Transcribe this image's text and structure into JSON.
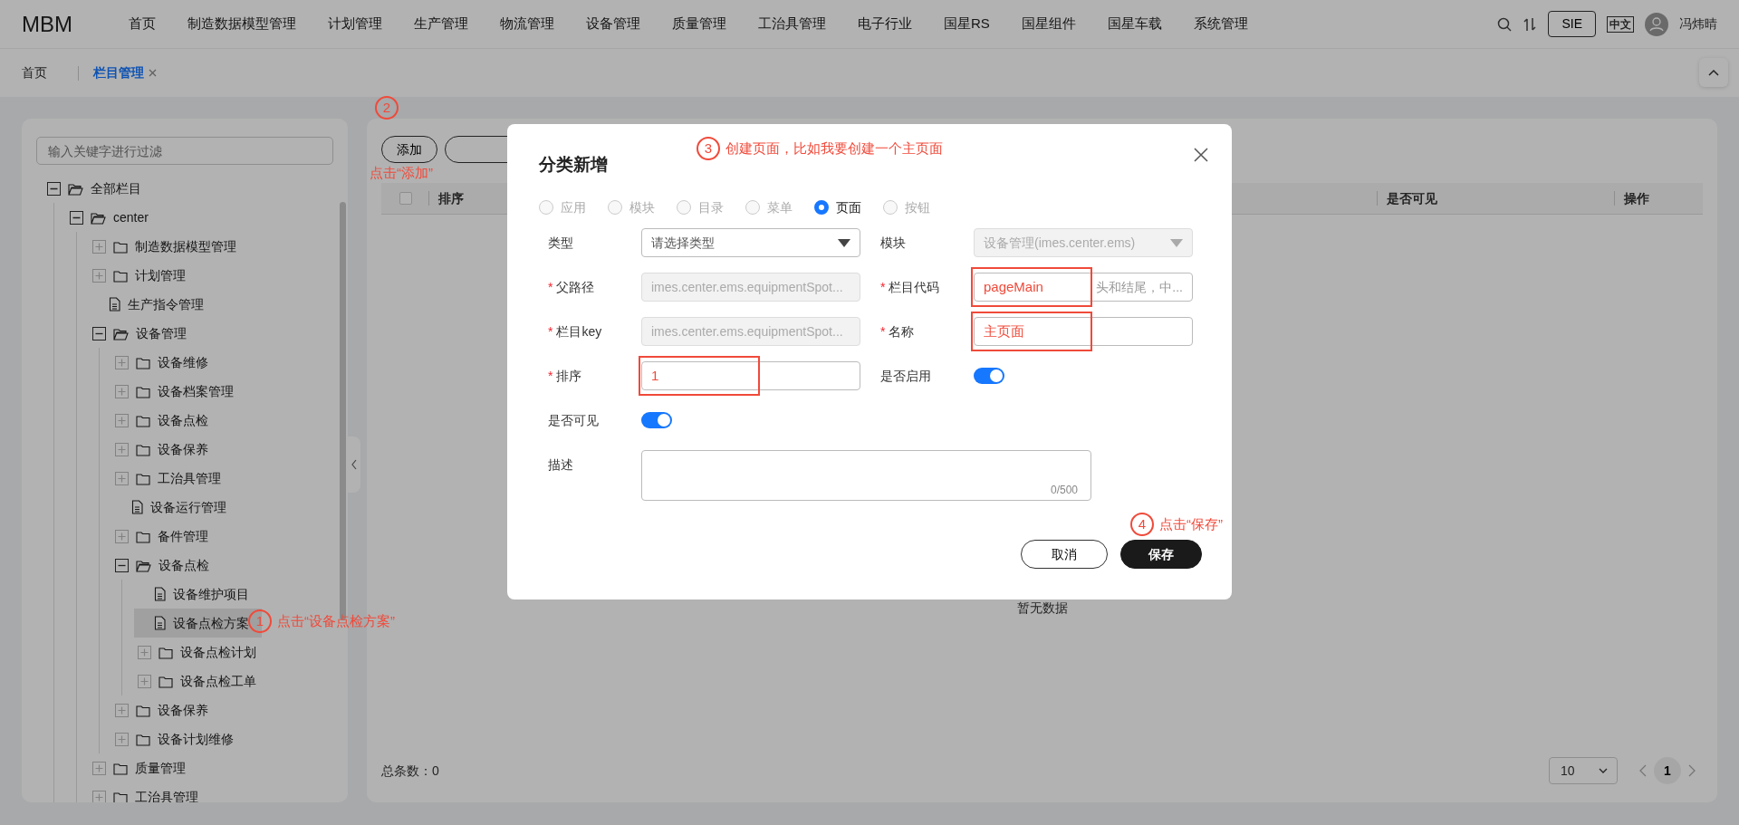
{
  "app": {
    "logo": "MBM"
  },
  "nav": [
    {
      "label": "首页"
    },
    {
      "label": "制造数据模型管理"
    },
    {
      "label": "计划管理"
    },
    {
      "label": "生产管理"
    },
    {
      "label": "物流管理"
    },
    {
      "label": "设备管理"
    },
    {
      "label": "质量管理"
    },
    {
      "label": "工治具管理"
    },
    {
      "label": "电子行业"
    },
    {
      "label": "国星RS"
    },
    {
      "label": "国星组件"
    },
    {
      "label": "国星车载"
    },
    {
      "label": "系统管理"
    }
  ],
  "header_right": {
    "org": "SIE",
    "language": "中文",
    "user": "冯炜晴"
  },
  "tabs": [
    {
      "label": "首页",
      "selected": false,
      "closable": false
    },
    {
      "label": "栏目管理",
      "selected": true,
      "closable": true
    }
  ],
  "table_select_all": {
    "checked": false
  },
  "tree": {
    "filter_placeholder": "输入关键字进行过滤",
    "nodes": [
      {
        "label": "全部栏目",
        "kind": "folder",
        "expanded": true,
        "selected": false,
        "children": [
          {
            "label": "center",
            "kind": "folder",
            "expanded": true,
            "selected": false,
            "children": [
              {
                "label": "制造数据模型管理",
                "kind": "folder",
                "expanded": false,
                "selected": false
              },
              {
                "label": "计划管理",
                "kind": "folder",
                "expanded": false,
                "selected": false
              },
              {
                "label": "生产指令管理",
                "kind": "file",
                "selected": false
              },
              {
                "label": "设备管理",
                "kind": "folder",
                "expanded": true,
                "selected": false,
                "children": [
                  {
                    "label": "设备维修",
                    "kind": "folder",
                    "expanded": false,
                    "selected": false
                  },
                  {
                    "label": "设备档案管理",
                    "kind": "folder",
                    "expanded": false,
                    "selected": false
                  },
                  {
                    "label": "设备点检",
                    "kind": "folder",
                    "expanded": false,
                    "selected": false
                  },
                  {
                    "label": "设备保养",
                    "kind": "folder",
                    "expanded": false,
                    "selected": false
                  },
                  {
                    "label": "工治具管理",
                    "kind": "folder",
                    "expanded": false,
                    "selected": false
                  },
                  {
                    "label": "设备运行管理",
                    "kind": "file",
                    "selected": false
                  },
                  {
                    "label": "备件管理",
                    "kind": "folder",
                    "expanded": false,
                    "selected": false
                  },
                  {
                    "label": "设备点检",
                    "kind": "folder",
                    "expanded": true,
                    "selected": false,
                    "children": [
                      {
                        "label": "设备维护项目",
                        "kind": "file",
                        "selected": false
                      },
                      {
                        "label": "设备点检方案",
                        "kind": "file",
                        "selected": true
                      },
                      {
                        "label": "设备点检计划",
                        "kind": "folder",
                        "expanded": false,
                        "selected": false
                      },
                      {
                        "label": "设备点检工单",
                        "kind": "folder",
                        "expanded": false,
                        "selected": false
                      }
                    ]
                  },
                  {
                    "label": "设备保养",
                    "kind": "folder",
                    "expanded": false,
                    "selected": false
                  },
                  {
                    "label": "设备计划维修",
                    "kind": "folder",
                    "expanded": false,
                    "selected": false
                  }
                ]
              },
              {
                "label": "质量管理",
                "kind": "folder",
                "expanded": false,
                "selected": false
              },
              {
                "label": "工治具管理",
                "kind": "folder",
                "expanded": false,
                "selected": false
              }
            ]
          }
        ]
      }
    ]
  },
  "toolbar": {
    "add_button": "添加"
  },
  "table": {
    "columns": [
      {
        "label": "排序"
      },
      {
        "label": "是否可见"
      },
      {
        "label": "操作"
      }
    ],
    "empty_text": "暂无数据"
  },
  "footer": {
    "total": "总条数：0",
    "page_size": "10",
    "pages": [
      {
        "label": "1",
        "selected": true
      }
    ]
  },
  "dialog": {
    "title": "分类新增",
    "types": [
      {
        "label": "应用",
        "selected": false,
        "disabled": true
      },
      {
        "label": "模块",
        "selected": false,
        "disabled": true
      },
      {
        "label": "目录",
        "selected": false,
        "disabled": true
      },
      {
        "label": "菜单",
        "selected": false,
        "disabled": true
      },
      {
        "label": "页面",
        "selected": true,
        "disabled": false
      },
      {
        "label": "按钮",
        "selected": false,
        "disabled": true
      }
    ],
    "rows": [
      [
        {
          "label": "类型",
          "kind": "select",
          "placeholder": "请选择类型",
          "disabled": false
        },
        {
          "label": "模块",
          "kind": "select",
          "value": "设备管理(imes.center.ems)",
          "disabled": true
        }
      ],
      [
        {
          "label": "父路径",
          "required_mark": "*",
          "kind": "input",
          "value": "imes.center.ems.equipmentSpot...",
          "disabled": true,
          "highlighted": false
        },
        {
          "label": "栏目代码",
          "required_mark": "*",
          "kind": "input",
          "value": "pageMain",
          "hint_tail": "头和结尾，中...",
          "disabled": false,
          "highlighted": true
        }
      ],
      [
        {
          "label": "栏目key",
          "required_mark": "*",
          "kind": "input",
          "value": "imes.center.ems.equipmentSpot...",
          "disabled": true,
          "highlighted": false
        },
        {
          "label": "名称",
          "required_mark": "*",
          "kind": "input",
          "value": "主页面",
          "disabled": false,
          "highlighted": true
        }
      ],
      [
        {
          "label": "排序",
          "required_mark": "*",
          "kind": "input",
          "value": "1",
          "disabled": false,
          "highlighted": true
        },
        {
          "label": "是否启用",
          "kind": "switch",
          "on": true
        }
      ],
      [
        {
          "label": "是否可见",
          "kind": "switch",
          "on": true
        }
      ],
      [
        {
          "label": "描述",
          "kind": "textarea",
          "counter": "0/500"
        }
      ]
    ],
    "buttons": [
      {
        "label": "取消",
        "kind": "secondary"
      },
      {
        "label": "保存",
        "kind": "primary"
      }
    ]
  },
  "annotations": [
    {
      "number": "1",
      "text": "点击“设备点检方案”"
    },
    {
      "number": "2",
      "text": "点击“添加”"
    },
    {
      "number": "3",
      "text": "创建页面，比如我要创建一个主页面"
    },
    {
      "number": "4",
      "text": "点击“保存”"
    }
  ]
}
